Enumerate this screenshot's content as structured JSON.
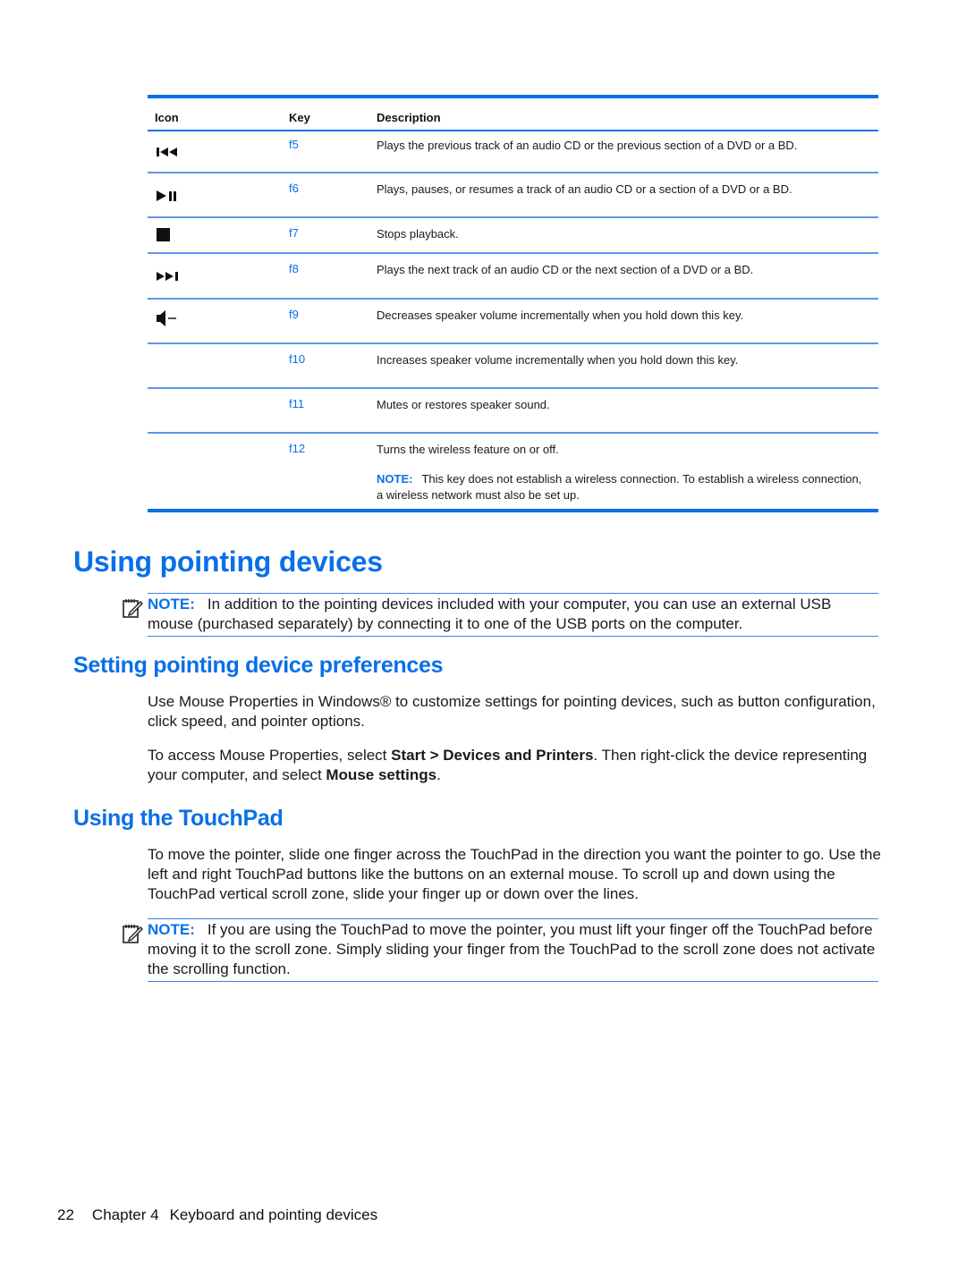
{
  "table": {
    "headers": {
      "icon": "Icon",
      "key": "Key",
      "description": "Description"
    },
    "rows": [
      {
        "icon": "previous-track-icon",
        "key": "f5",
        "description": "Plays the previous track of an audio CD or the previous section of a DVD or a BD."
      },
      {
        "icon": "play-pause-icon",
        "key": "f6",
        "description": "Plays, pauses, or resumes a track of an audio CD or a section of a DVD or a BD."
      },
      {
        "icon": "stop-icon",
        "key": "f7",
        "description": "Stops playback."
      },
      {
        "icon": "next-track-icon",
        "key": "f8",
        "description": "Plays the next track of an audio CD or the next section of a DVD or a BD."
      },
      {
        "icon": "volume-down-icon",
        "key": "f9",
        "description": "Decreases speaker volume incrementally when you hold down this key."
      },
      {
        "icon": "",
        "key": "f10",
        "description": "Increases speaker volume incrementally when you hold down this key."
      },
      {
        "icon": "",
        "key": "f11",
        "description": "Mutes or restores speaker sound."
      },
      {
        "icon": "",
        "key": "f12",
        "description": "Turns the wireless feature on or off.",
        "note_label": "NOTE:",
        "note_text": "This key does not establish a wireless connection. To establish a wireless connection, a wireless network must also be set up."
      }
    ]
  },
  "section_pointing": {
    "title": "Using pointing devices",
    "note_label": "NOTE:",
    "note_text": "In addition to the pointing devices included with your computer, you can use an external USB mouse (purchased separately) by connecting it to one of the USB ports on the computer."
  },
  "section_prefs": {
    "title": "Setting pointing device preferences",
    "para1": "Use Mouse Properties in Windows® to customize settings for pointing devices, such as button configuration, click speed, and pointer options.",
    "para2_prefix": "To access Mouse Properties, select ",
    "para2_bold1": "Start > Devices and Printers",
    "para2_mid": ". Then right-click the device representing your computer, and select ",
    "para2_bold2": "Mouse settings",
    "para2_suffix": "."
  },
  "section_touchpad": {
    "title": "Using the TouchPad",
    "para1": "To move the pointer, slide one finger across the TouchPad in the direction you want the pointer to go. Use the left and right TouchPad buttons like the buttons on an external mouse. To scroll up and down using the TouchPad vertical scroll zone, slide your finger up or down over the lines.",
    "note_label": "NOTE:",
    "note_text": "If you are using the TouchPad to move the pointer, you must lift your finger off the TouchPad before moving it to the scroll zone. Simply sliding your finger from the TouchPad to the scroll zone does not activate the scrolling function."
  },
  "footer": {
    "page_number": "22",
    "chapter": "Chapter 4",
    "chapter_title": "Keyboard and pointing devices"
  },
  "colors": {
    "accent": "#0a6fe8",
    "text": "#1a1a1a"
  }
}
